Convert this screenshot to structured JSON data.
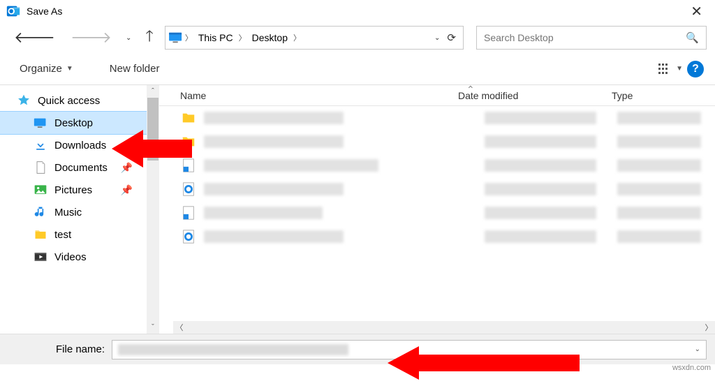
{
  "window": {
    "title": "Save As"
  },
  "breadcrumb": {
    "root": "This PC",
    "folder": "Desktop"
  },
  "search": {
    "placeholder": "Search Desktop"
  },
  "toolbar": {
    "organize": "Organize",
    "newfolder": "New folder"
  },
  "columns": {
    "name": "Name",
    "date": "Date modified",
    "type": "Type"
  },
  "sidebar": {
    "quick_access": "Quick access",
    "desktop": "Desktop",
    "downloads": "Downloads",
    "documents": "Documents",
    "pictures": "Pictures",
    "music": "Music",
    "test": "test",
    "videos": "Videos"
  },
  "filename": {
    "label": "File name:"
  },
  "watermark": "wsxdn.com"
}
